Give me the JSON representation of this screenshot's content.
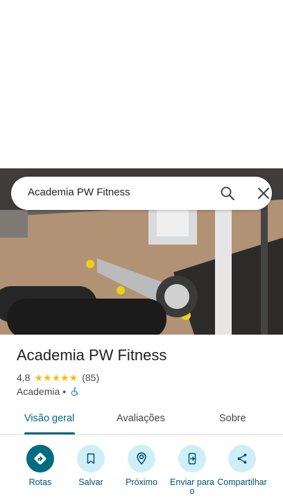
{
  "search": {
    "query": "Academia PW Fitness",
    "icons": [
      "search-icon",
      "close-icon"
    ]
  },
  "place": {
    "name": "Academia PW Fitness",
    "rating": "4,8",
    "stars": "★★★★★",
    "reviews_count": "(85)",
    "category": "Academia",
    "separator": "•",
    "accessibility_icon": "wheelchair-icon"
  },
  "tabs": [
    {
      "label": "Visão geral",
      "active": true
    },
    {
      "label": "Avaliações",
      "active": false
    },
    {
      "label": "Sobre",
      "active": false
    }
  ],
  "actions": [
    {
      "label": "Rotas",
      "icon": "directions-icon"
    },
    {
      "label": "Salvar",
      "icon": "bookmark-icon"
    },
    {
      "label": "Próximo",
      "icon": "nearby-icon"
    },
    {
      "label": "Enviar para o",
      "icon": "send-to-phone-icon"
    },
    {
      "label": "Compartilhar",
      "icon": "share-icon"
    }
  ],
  "colors": {
    "accent": "#00677d",
    "action_bg": "#cfeff8",
    "primary_action": "#006c80",
    "star": "#fbbc04"
  }
}
